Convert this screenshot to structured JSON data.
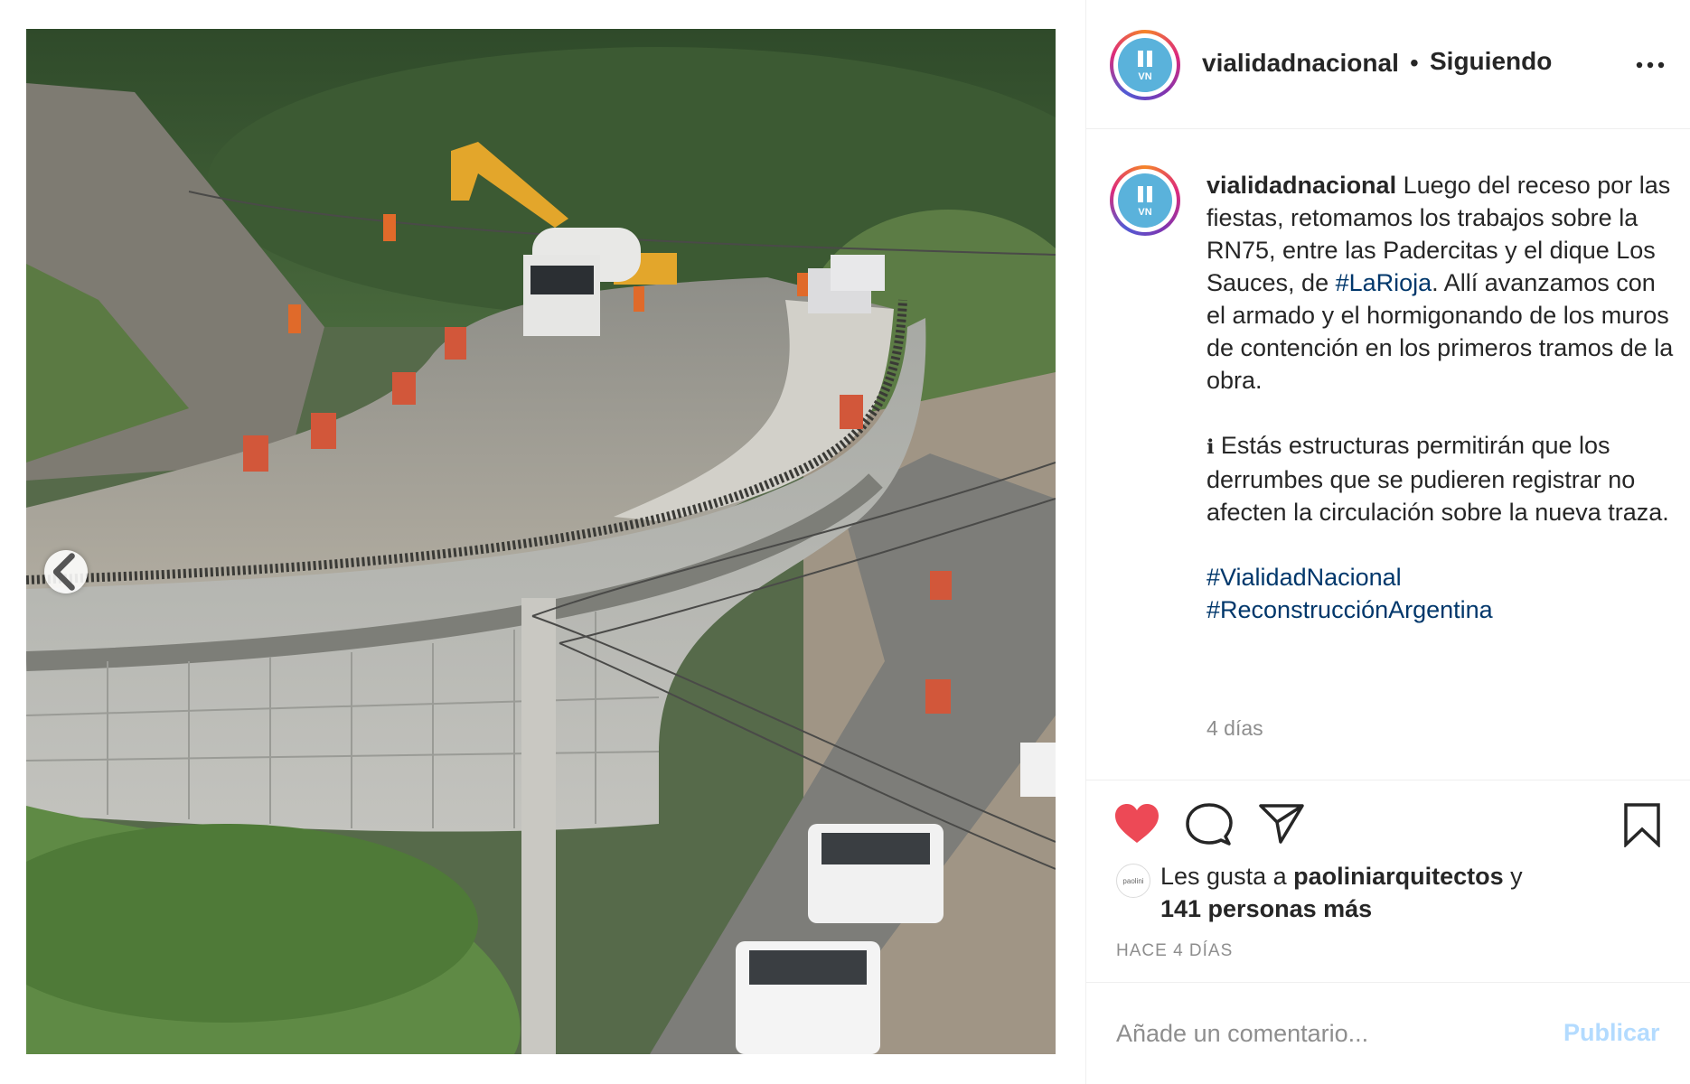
{
  "post": {
    "account": "vialidadnacional",
    "avatar_text": "VN",
    "follow_separator": "•",
    "follow_status": "Siguiendo",
    "more_icon": "more-horizontal-icon",
    "caption": {
      "user": "vialidadnacional",
      "p1_text": " Luego del receso por las fiestas, retomamos los trabajos sobre la RN75, entre las Padercitas y el dique Los Sauces, de ",
      "p1_tag": "#LaRioja",
      "p1_end": ". Allí avanzamos con el armado y el hormigonando de los muros de contención en los primeros tramos de la obra.",
      "p2_icon": "ℹ",
      "p2_text": " Estás estructuras permitirán que los derrumbes que se pudieren registrar no afecten la circulación sobre la nueva traza.",
      "hashtags": [
        "#VialidadNacional",
        "#ReconstrucciónArgentina"
      ]
    },
    "time_ago": "4 días",
    "likes": {
      "avatar_label": "paolini",
      "prefix": "Les gusta a ",
      "user": "paoliniarquitectos",
      "connector": " y",
      "others": "141 personas más"
    },
    "timestamp": "HACE 4 DÍAS",
    "comment_placeholder": "Añade un comentario...",
    "publish_label": "Publicar",
    "liked": true,
    "carousel": {
      "slides": 2,
      "current": 2
    }
  },
  "colors": {
    "like_red": "#ed4956",
    "link_blue": "#00376b",
    "publish_disabled": "#b3dbff",
    "muted": "#8e8e8e",
    "avatar_blue": "#5ab2db"
  }
}
